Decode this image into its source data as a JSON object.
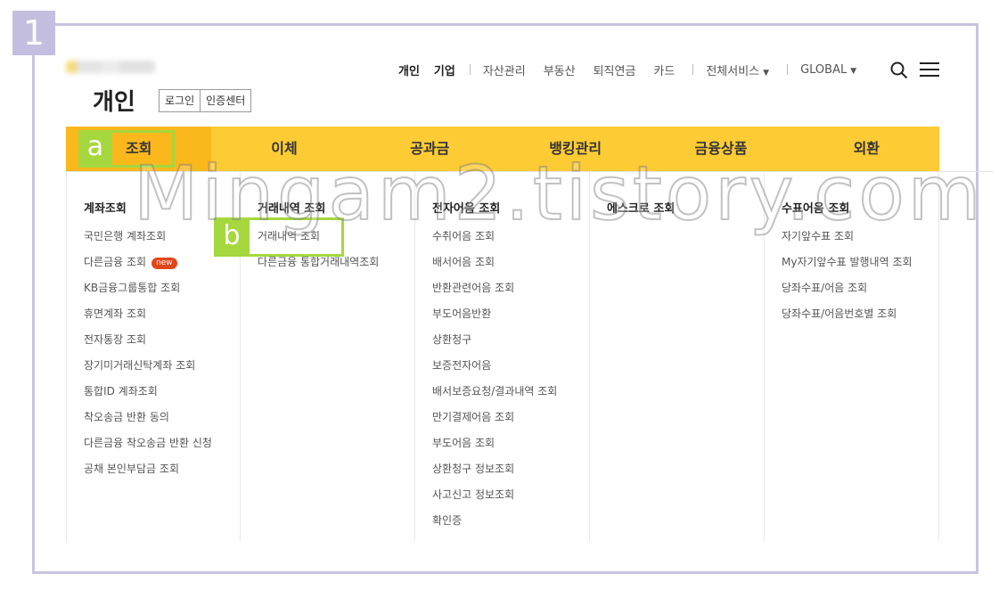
{
  "step": "1",
  "header": {
    "title": "개인",
    "auth": {
      "login": "로그인",
      "cert_center": "인증센터"
    },
    "util_nav": {
      "personal": "개인",
      "business": "기업",
      "asset": "자산관리",
      "real_estate": "부동산",
      "pension": "퇴직연금",
      "card": "카드",
      "all_services": "전체서비스",
      "global": "GLOBAL"
    }
  },
  "gnb": {
    "tabs": [
      {
        "label": "조회"
      },
      {
        "label": "이체"
      },
      {
        "label": "공과금"
      },
      {
        "label": "뱅킹관리"
      },
      {
        "label": "금융상품"
      },
      {
        "label": "외환"
      }
    ]
  },
  "mega_menu": {
    "columns": [
      {
        "title": "계좌조회",
        "items": [
          "국민은행 계좌조회",
          "다른금융 조회",
          "KB금융그룹통합 조회",
          "휴면계좌 조회",
          "전자통장 조회",
          "장기미거래신탁계좌 조회",
          "통합ID 계좌조회",
          "착오송금 반환 동의",
          "다른금융 착오송금 반환 신청",
          "공채 본인부담금 조회"
        ],
        "new_badge": "new"
      },
      {
        "title": "거래내역 조회",
        "items": [
          "거래내역 조회",
          "다른금융 통합거래내역조회"
        ]
      },
      {
        "title": "전자어음 조회",
        "items": [
          "수취어음 조회",
          "배서어음 조회",
          "반환관련어음 조회",
          "부도어음반환",
          "상환청구",
          "보증전자어음",
          "배서보증요청/결과내역 조회",
          "만기결제어음 조회",
          "부도어음 조회",
          "상환청구 정보조회",
          "사고신고 정보조회",
          "확인증"
        ]
      },
      {
        "title": "에스크로 조회",
        "items": []
      },
      {
        "title": "수표어음 조회",
        "items": [
          "자기앞수표 조회",
          "My자기앞수표 발행내역 조회",
          "당좌수표/어음 조회",
          "당좌수표/어음번호별 조회"
        ]
      }
    ]
  },
  "callouts": {
    "a": "a",
    "b": "b"
  },
  "watermark": "Mingam2.tistory.com",
  "colors": {
    "gnb": "#fdcb34",
    "gnb_active": "#fbb81d",
    "callout": "#a5d83e",
    "frame": "#c9c3e0"
  }
}
